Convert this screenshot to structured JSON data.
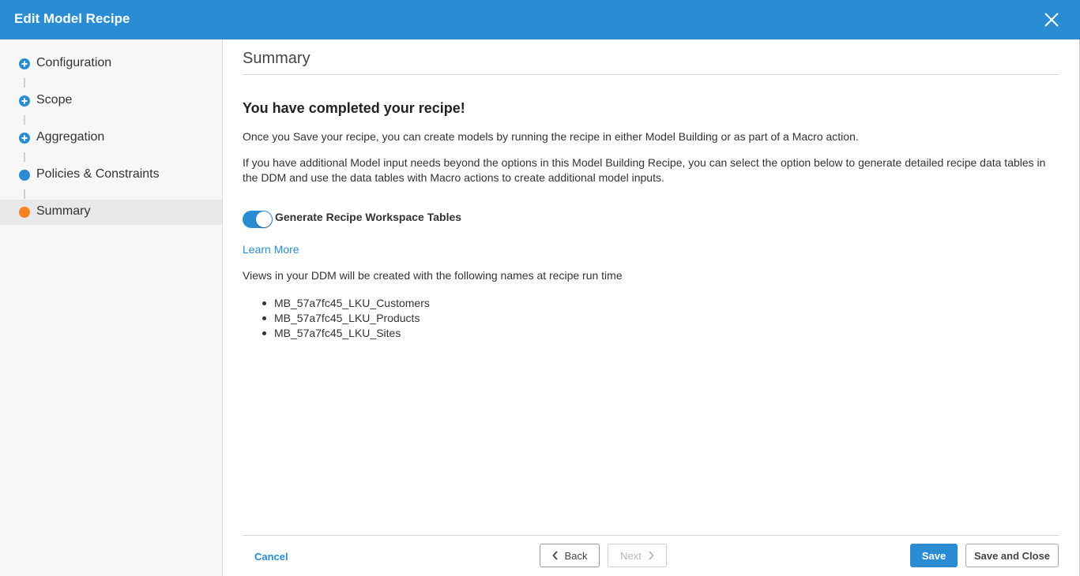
{
  "window": {
    "title": "Edit Model Recipe"
  },
  "steps": [
    {
      "label": "Configuration",
      "status": "add"
    },
    {
      "label": "Scope",
      "status": "add"
    },
    {
      "label": "Aggregation",
      "status": "add"
    },
    {
      "label": "Policies & Constraints",
      "status": "done"
    },
    {
      "label": "Summary",
      "status": "current"
    }
  ],
  "summary": {
    "section_title": "Summary",
    "heading": "You have completed your recipe!",
    "para1": "Once you Save your recipe, you can create models by running the recipe in either Model Building or as part of a Macro action.",
    "para2": "If you have additional Model input needs beyond the options in this Model Building Recipe, you can select the option below to generate detailed recipe data tables in the DDM and use the data tables with Macro actions to create additional model inputs.",
    "toggle_label": "Generate Recipe Workspace Tables",
    "toggle_on": true,
    "learn_more": "Learn More",
    "views_intro": "Views in your DDM will be created with the following names at recipe run time",
    "views": [
      "MB_57a7fc45_LKU_Customers",
      "MB_57a7fc45_LKU_Products",
      "MB_57a7fc45_LKU_Sites"
    ]
  },
  "footer": {
    "cancel": "Cancel",
    "back": "Back",
    "next": "Next",
    "save": "Save",
    "save_close": "Save and Close"
  },
  "colors": {
    "accent": "#2a8dd4",
    "current_step": "#f58220"
  }
}
